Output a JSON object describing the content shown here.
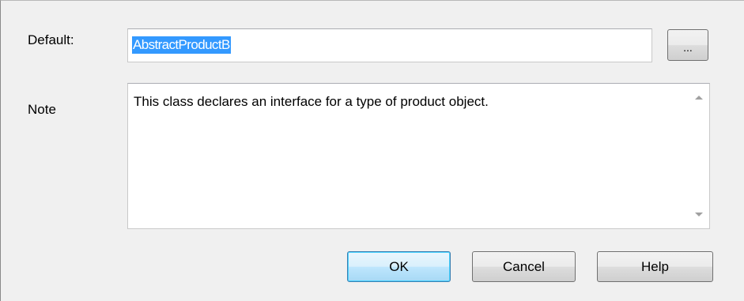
{
  "default_field": {
    "label": "Default:",
    "value": "AbstractProductB",
    "browse_label": "..."
  },
  "note_field": {
    "label": "Note",
    "value": "This class declares an interface for a type of product object."
  },
  "buttons": {
    "ok": "OK",
    "cancel": "Cancel",
    "help": "Help"
  },
  "colors": {
    "selection": "#3399ff",
    "dialog_bg": "#f0f0f0",
    "ok_border": "#3c7fb1"
  }
}
